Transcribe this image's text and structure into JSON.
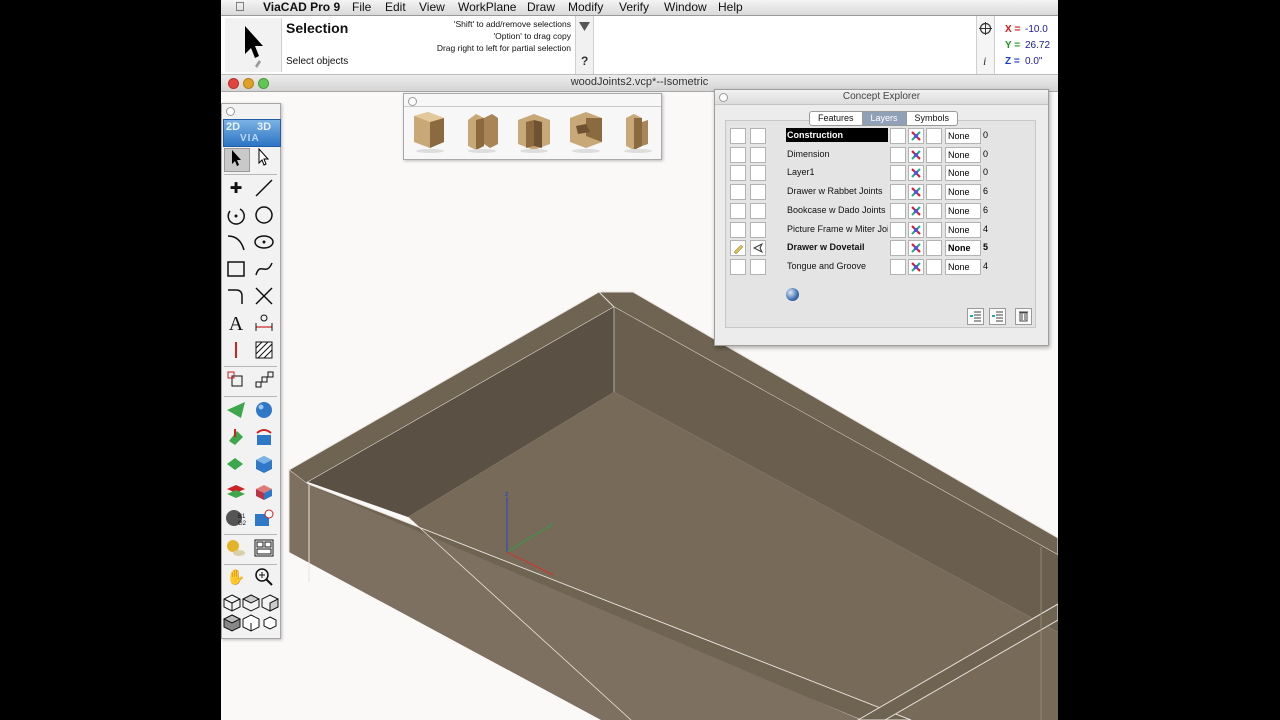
{
  "menubar": {
    "app_name": "ViaCAD Pro 9",
    "items": [
      "File",
      "Edit",
      "View",
      "WorkPlane",
      "Draw",
      "Modify",
      "Verify",
      "Window",
      "Help"
    ]
  },
  "tool": {
    "title": "Selection",
    "hint": "Select objects",
    "help_lines": [
      "'Shift' to add/remove selections",
      "'Option' to drag copy",
      "Drag right to left for partial selection"
    ],
    "help_button": "?",
    "info_button": "i"
  },
  "coords": {
    "x_label": "X =",
    "x_value": "-10.0",
    "y_label": "Y =",
    "y_value": "26.72",
    "z_label": "Z =",
    "z_value": "0.0\""
  },
  "document": {
    "title": "woodJoints2.vcp*--Isometric"
  },
  "palette": {
    "badge_2d": "2D",
    "badge_3d": "3D",
    "badge_via": "VIA"
  },
  "joints_palette": {
    "icons": [
      "rabbet-joint-icon",
      "dado-joint-icon",
      "box-joint-icon",
      "dovetail-joint-icon",
      "tongue-groove-joint-icon"
    ]
  },
  "explorer": {
    "title": "Concept Explorer",
    "tabs": [
      "Features",
      "Layers",
      "Symbols"
    ],
    "active_tab": "Layers",
    "layers": [
      {
        "name": "Construction",
        "line": "None",
        "count": "0",
        "selected": true,
        "active": false
      },
      {
        "name": "Dimension",
        "line": "None",
        "count": "0",
        "selected": false,
        "active": false
      },
      {
        "name": "Layer1",
        "line": "None",
        "count": "0",
        "selected": false,
        "active": false
      },
      {
        "name": "Drawer w Rabbet Joints",
        "line": "None",
        "count": "6",
        "selected": false,
        "active": false
      },
      {
        "name": "Bookcase w Dado Joints",
        "line": "None",
        "count": "6",
        "selected": false,
        "active": false
      },
      {
        "name": "Picture Frame w Miter Joints",
        "line": "None",
        "count": "4",
        "selected": false,
        "active": false
      },
      {
        "name": "Drawer w Dovetail",
        "line": "None",
        "count": "5",
        "selected": false,
        "active": true
      },
      {
        "name": "Tongue and Groove",
        "line": "None",
        "count": "4",
        "selected": false,
        "active": false
      }
    ]
  },
  "colors": {
    "wood_top": "#6f6352",
    "wood_inner_wall": "#5a5043",
    "wood_floor": "#776a58",
    "wood_front": "#7e7060",
    "selection_tab": "#8fa0b7"
  }
}
